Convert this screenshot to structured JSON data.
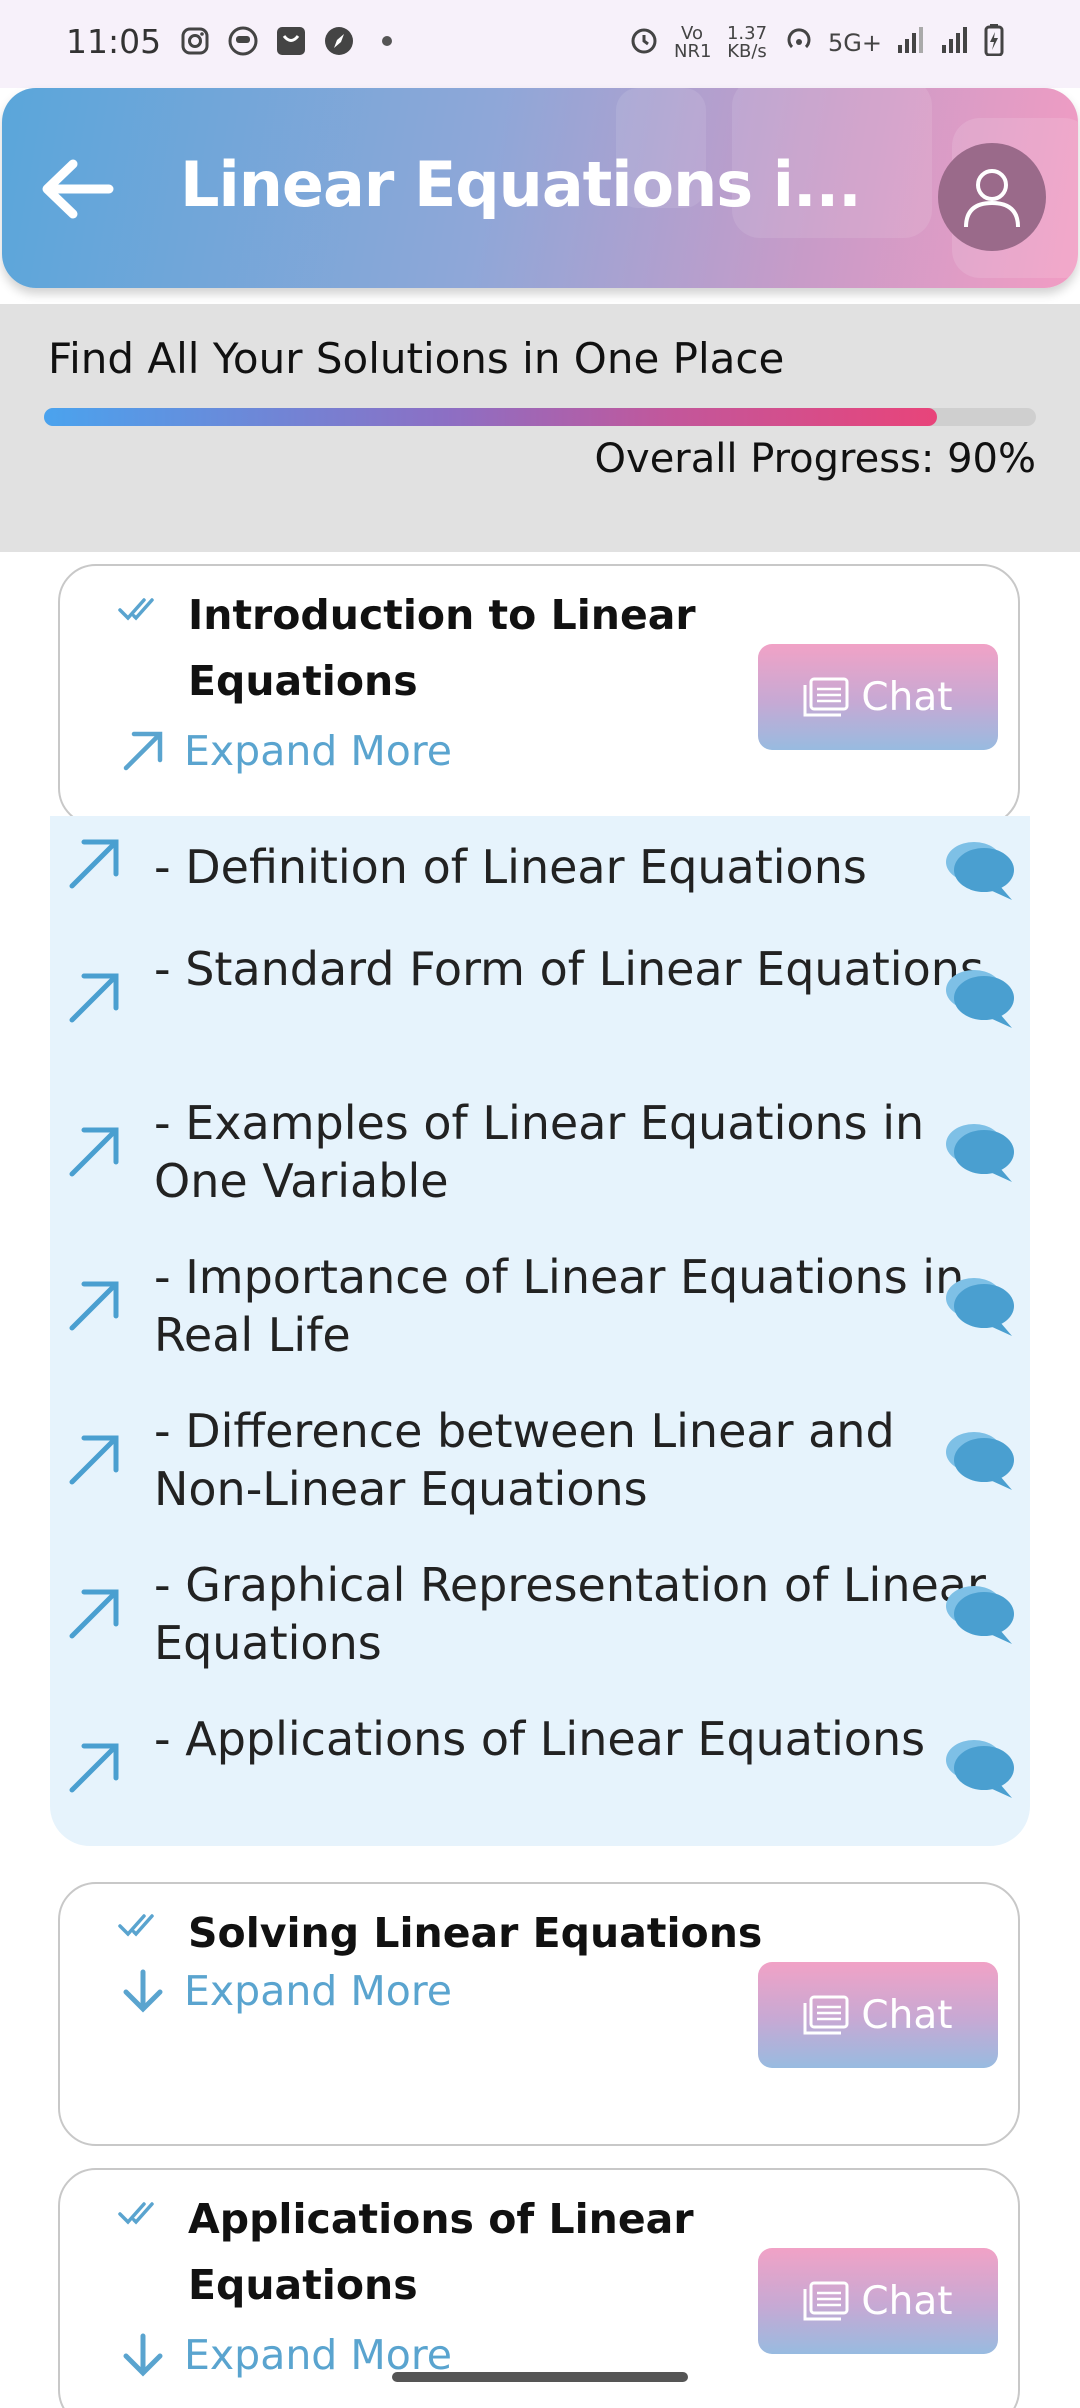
{
  "status_bar": {
    "time": "11:05",
    "left_icons": [
      "instagram-icon",
      "app-icon",
      "bag-icon",
      "compass-icon",
      "dot-icon"
    ],
    "right_icons": [
      "alarm-icon",
      "volte-icon",
      "hotspot-icon",
      "signal-icon",
      "signal-icon",
      "battery-icon"
    ],
    "volte": "Vo NR1",
    "speed": "1.37 KB/s",
    "network": "5G+"
  },
  "header": {
    "title": "Linear Equations i...",
    "back_icon": "arrow-left-icon",
    "avatar_icon": "user-icon"
  },
  "progress": {
    "tagline": "Find All Your Solutions in One Place",
    "label": "Overall Progress: 90%",
    "value": 0.9
  },
  "topics": [
    {
      "title": "Introduction to Linear Equations",
      "expand_label": "Expand More",
      "expand_icon": "arrow-up-right-icon",
      "chat_label": "Chat",
      "expanded": true,
      "subtopics": [
        "- Definition of Linear Equations",
        "- Standard Form of Linear Equations",
        "- Examples of Linear Equations in One Variable",
        "- Importance of Linear Equations in Real Life",
        "- Difference between Linear and Non-Linear Equations",
        "- Graphical Representation of Linear Equations",
        "- Applications of Linear Equations"
      ]
    },
    {
      "title": "Solving Linear Equations",
      "expand_label": "Expand More",
      "expand_icon": "arrow-down-icon",
      "chat_label": "Chat",
      "expanded": false
    },
    {
      "title": "Applications of Linear Equations",
      "expand_label": "Expand More",
      "expand_icon": "arrow-down-icon",
      "chat_label": "Chat",
      "expanded": false
    }
  ],
  "colors": {
    "accent_blue": "#5aa4cf",
    "progress_start": "#4aa3ee",
    "progress_end": "#e8447a",
    "subtopic_bg": "#e6f3fc",
    "chat_icon": "#4a9fd0"
  }
}
